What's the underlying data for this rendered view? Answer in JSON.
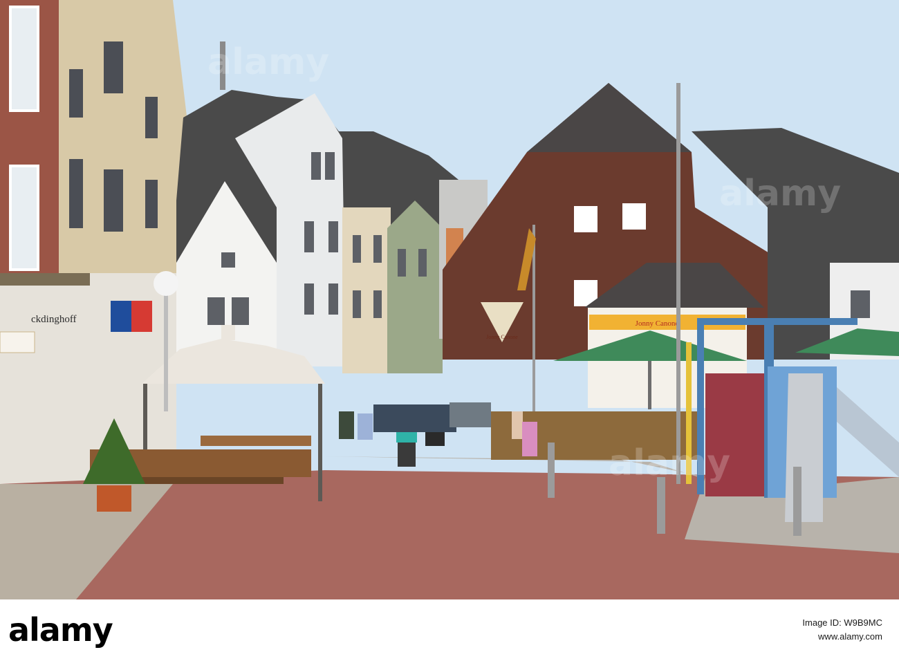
{
  "photo": {
    "kind": "street-scene",
    "signs": {
      "shop_left": "ckdinghoff",
      "pub_name": "Jonny Canone",
      "pub_kiosk": "Jonny Canone"
    }
  },
  "watermark": {
    "text": "alamy"
  },
  "footer": {
    "logo": "alamy",
    "image_id_label": "Image ID: W9B9MC",
    "url": "www.alamy.com"
  },
  "colors": {
    "sky": "#cfe3f3",
    "brick": "#9b5546",
    "pavement_red": "#a8685f",
    "roof_dark": "#4a4a4a",
    "umbrella_green": "#3f8a5a",
    "playground_blue": "#4a7fb3"
  }
}
